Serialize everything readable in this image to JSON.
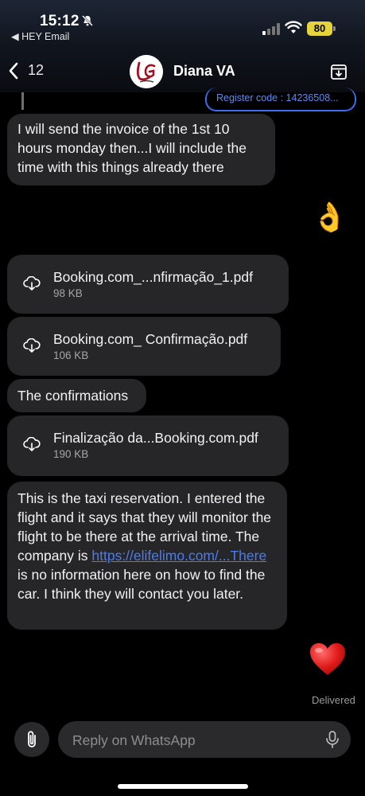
{
  "status_bar": {
    "time": "15:12",
    "back_app": "◀ HEY Email",
    "battery": "80"
  },
  "header": {
    "back_count": "12",
    "contact_name": "Diana VA",
    "avatar_icon": "logo-LG-icon"
  },
  "messages": {
    "register_code": "Register code : 14236508...",
    "m1": "I will send the invoice of the 1st 10 hours monday then...I will include the time with this things already there",
    "emoji_ok": "👌",
    "file1": {
      "name": "Booking.com_...nfirmação_1.pdf",
      "size": "98 KB"
    },
    "file2": {
      "name": "Booking.com_ Confirmação.pdf",
      "size": "106 KB"
    },
    "m2": "The confirmations",
    "file3": {
      "name": "Finalização da...Booking.com.pdf",
      "size": "190 KB"
    },
    "m3_part1": "This is the taxi reservation. I entered the flight and it says that they will monitor the flight to be there at the arrival time. The company is ",
    "m3_link": "https://elifelimo.com/...There",
    "m3_part2": " is no information here on how to find the car. I think they will contact you later.",
    "reaction": "heart",
    "delivered": "Delivered"
  },
  "composer": {
    "placeholder": "Reply on WhatsApp"
  },
  "colors": {
    "bubble": "#262629",
    "link": "#4a7cf0",
    "battery": "#e5d43b"
  }
}
